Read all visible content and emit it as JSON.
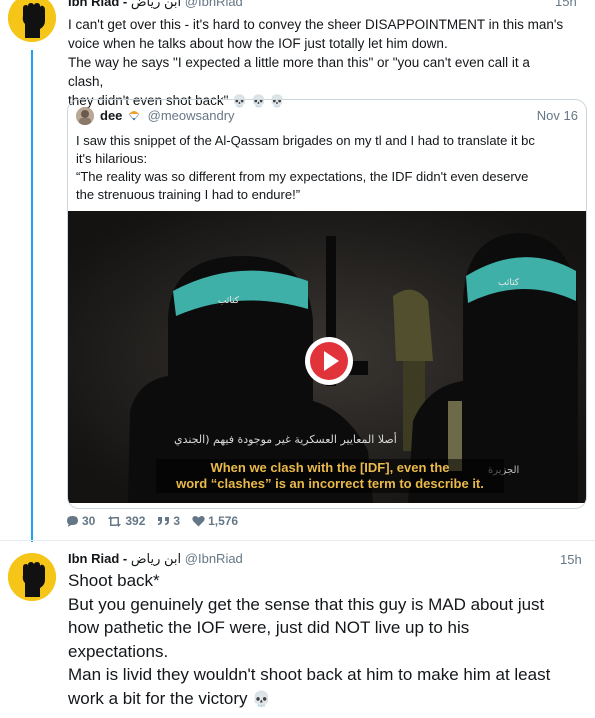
{
  "tweet1": {
    "name": "Ibn Riad -",
    "arabic_name": "ابن رياض",
    "handle": "@IbnRiad",
    "time": "15h",
    "lines": [
      "I can't get over this - it's hard to convey the sheer DISAPPOINTMENT in this man's",
      "voice when he talks about how the IOF just totally let him down.",
      "The way he says \"I expected a little more than this\" or \"you can't even call it a clash,",
      "they didn't even shot back\""
    ],
    "emoji": "💀 💀 💀"
  },
  "quote": {
    "name": "dee",
    "handle": "@meowsandry",
    "time": "Nov 16",
    "lines": [
      "I saw this snippet of the Al-Qassam brigades on my tl and I had to translate it bc",
      "it's hilarious:",
      "“The reality was so different from my expectations, the IDF didn't even deserve",
      "the strenuous training I had to endure!”"
    ],
    "video": {
      "arabic_caption": "أصلا المعايير العسكرية غير موجودة فيهم (الجندي",
      "caption_line1": "When we clash with the [IDF], even the",
      "caption_line2": "word “clashes” is an incorrect term to describe it."
    }
  },
  "stats": {
    "replies": "30",
    "retweets": "392",
    "quotes": "3",
    "likes": "1,576"
  },
  "tweet2": {
    "name": "Ibn Riad -",
    "arabic_name": "ابن رياض",
    "handle": "@IbnRiad",
    "time": "15h",
    "lines": [
      "Shoot back*",
      "But you genuinely get the sense that this guy is MAD about just",
      "how pathetic the IOF were, just did NOT live up to his",
      "expectations.",
      "Man is livid they wouldn't shoot back at him to make him at least",
      "work a bit for the victory"
    ],
    "emoji": "💀"
  },
  "colors": {
    "accent": "#1da1f2",
    "play_button": "#e0333a",
    "caption": "#e9b94a",
    "avatar_bg": "#f5c518"
  }
}
